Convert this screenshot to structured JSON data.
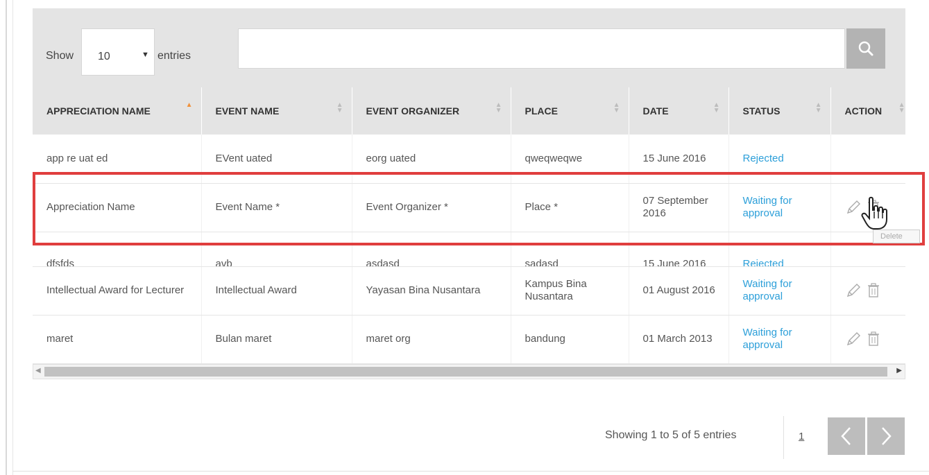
{
  "toolbar": {
    "show_label": "Show",
    "page_size": "10",
    "entries_label": "entries",
    "search_placeholder": ""
  },
  "table": {
    "columns": [
      "APPRECIATION NAME",
      "EVENT NAME",
      "EVENT ORGANIZER",
      "PLACE",
      "DATE",
      "STATUS",
      "ACTION"
    ],
    "sorted_column": "APPRECIATION NAME",
    "rows": [
      {
        "appreciation": "app re uat ed",
        "event": "EVent uated",
        "organizer": "eorg uated",
        "place": "qweqweqwe",
        "date": "15 June 2016",
        "status": "Rejected",
        "actions": false
      },
      {
        "appreciation": "Appreciation Name",
        "event": "Event Name *",
        "organizer": "Event Organizer *",
        "place": "Place *",
        "date": "07 September 2016",
        "status": "Waiting for approval",
        "actions": true
      },
      {
        "appreciation": "dfsfds",
        "event": "avb",
        "organizer": "asdasd",
        "place": "sadasd",
        "date": "15 June 2016",
        "status": "Rejected",
        "actions": false
      },
      {
        "appreciation": "Intellectual Award for Lecturer",
        "event": "Intellectual Award",
        "organizer": "Yayasan Bina Nusantara",
        "place": "Kampus Bina Nusantara",
        "date": "01 August 2016",
        "status": "Waiting for approval",
        "actions": true
      },
      {
        "appreciation": "maret",
        "event": "Bulan maret",
        "organizer": "maret org",
        "place": "bandung",
        "date": "01 March 2013",
        "status": "Waiting for approval",
        "actions": true
      }
    ]
  },
  "tooltip": {
    "text": "Delete"
  },
  "footer": {
    "info": "Showing 1 to 5 of 5 entries",
    "page": "1"
  },
  "colors": {
    "accent_link": "#2c9fd9",
    "highlight_border": "#e03e3e",
    "sort_active": "#f0913a"
  },
  "icons": {
    "search": "search-icon",
    "edit": "pencil-icon",
    "delete": "trash-icon",
    "prev": "chevron-left-icon",
    "next": "chevron-right-icon",
    "cursor": "hand-pointer-icon"
  }
}
